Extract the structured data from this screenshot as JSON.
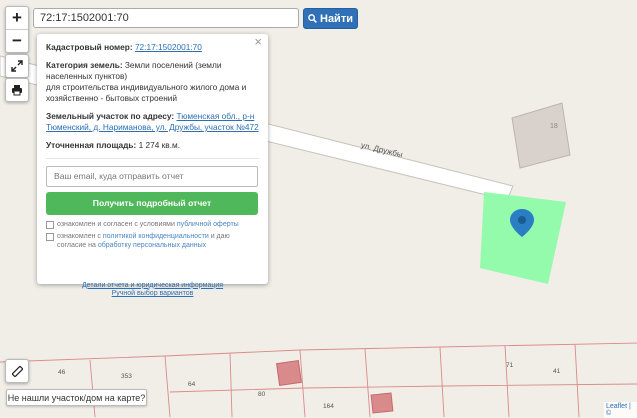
{
  "search": {
    "value": "72:17:1502001:70",
    "button_label": "Найти"
  },
  "controls": {
    "zoom_in": "+",
    "zoom_out": "−"
  },
  "popup": {
    "close": "×",
    "cadastral_label": "Кадастровый номер:",
    "cadastral_value": "72:17:1502001:70",
    "category_label": "Категория земель:",
    "category_value": "Земли поселений (земли населенных пунктов)",
    "category_use": "для строительства индивидуального жилого дома и хозяйственно - бытовых строений",
    "address_label": "Земельный участок по адресу:",
    "address_value": "Тюменская обл., р-н Тюменский, д. Нариманова, ул. Дружбы, участок №472",
    "area_label": "Уточненная площадь:",
    "area_value": "1 274 кв.м.",
    "email_placeholder": "Ваш email, куда отправить отчет",
    "report_button": "Получить подробный отчет",
    "check1_text": "ознакомлен и согласен с условиями",
    "check1_link": "публичной оферты",
    "check2_text": "ознакомлен с",
    "check2_link1": "политикой конфиденциальности",
    "check2_mid": "и даю согласие на",
    "check2_link2": "обработку персональных данных",
    "details_link": "Детали отчета и юридическая информация",
    "manual_link": "Ручной выбор вариантов"
  },
  "map": {
    "street_label": "ул. Дружбы",
    "building_number": "18",
    "bottom_labels": [
      "46",
      "353",
      "64",
      "80",
      "164",
      "71",
      "41"
    ],
    "parcel_color": "#8dfba8",
    "marker_color": "#2a7fc4"
  },
  "not_found_button": "Не нашли участок/дом на карте?",
  "attribution": "Leaflet | ©"
}
